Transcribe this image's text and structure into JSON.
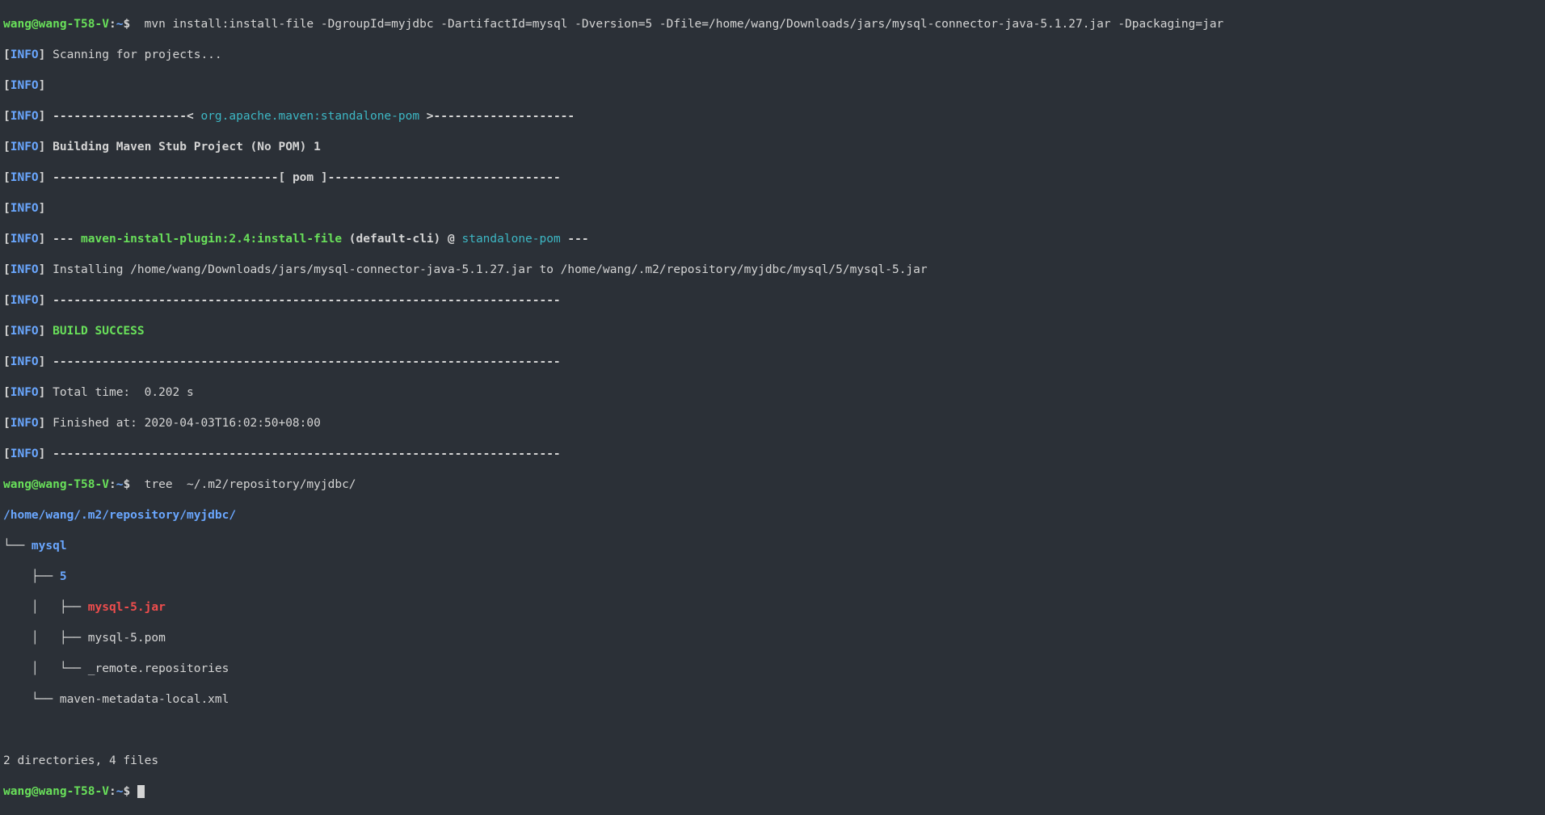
{
  "prompt": {
    "user": "wang",
    "host": "wang-T58-V",
    "path": "~",
    "sep1": "@",
    "sep2": ":",
    "dollar": "$ "
  },
  "cmd1": " mvn install:install-file -DgroupId=myjdbc -DartifactId=mysql -Dversion=5 -Dfile=/home/wang/Downloads/jars/mysql-connector-java-5.1.27.jar -Dpackaging=jar",
  "info": {
    "open": "[",
    "tag": "INFO",
    "close": "] "
  },
  "l": {
    "scan": "Scanning for projects...",
    "dash_open1": "-------------------< ",
    "ga": "org.apache.maven:standalone-pom",
    "dash_close1": " >--------------------",
    "build_stub": "Building Maven Stub Project (No POM) 1",
    "dash_pom1": "--------------------------------[ ",
    "pom": "pom",
    "dash_pom2": " ]---------------------------------",
    "plug_pre": "--- ",
    "plug": "maven-install-plugin:2.4:install-file",
    "plug_mid": " (default-cli)",
    "plug_at": " @ ",
    "plug_proj": "standalone-pom",
    "plug_post": " ---",
    "install": "Installing /home/wang/Downloads/jars/mysql-connector-java-5.1.27.jar to /home/wang/.m2/repository/myjdbc/mysql/5/mysql-5.jar",
    "sep72": "------------------------------------------------------------------------",
    "build_success": "BUILD SUCCESS",
    "total": "Total time:  0.202 s",
    "finished": "Finished at: 2020-04-03T16:02:50+08:00"
  },
  "cmd2": " tree  ~/.m2/repository/myjdbc/",
  "tree": {
    "root": "/home/wang/.m2/repository/myjdbc/",
    "n1_pre": "└── ",
    "n1": "mysql",
    "n2_pre": "    ├── ",
    "n2": "5",
    "n3_pre": "    │   ├── ",
    "n3": "mysql-5.jar",
    "n4_pre": "    │   ├── ",
    "n4": "mysql-5.pom",
    "n5_pre": "    │   └── ",
    "n5": "_remote.repositories",
    "n6_pre": "    └── ",
    "n6": "maven-metadata-local.xml"
  },
  "summary_blank": "",
  "summary": "2 directories, 4 files"
}
